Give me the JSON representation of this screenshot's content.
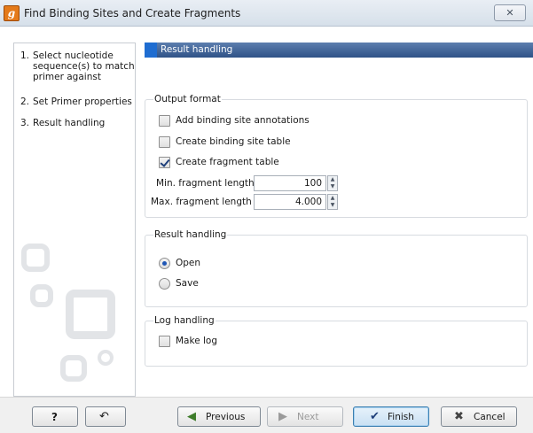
{
  "window": {
    "title": "Find Binding Sites and Create Fragments",
    "icon_glyph": "g",
    "close_symbol": "✕"
  },
  "steps": [
    {
      "num": "1.",
      "label": "Select nucleotide sequence(s) to match primer against"
    },
    {
      "num": "2.",
      "label": "Set Primer properties"
    },
    {
      "num": "3.",
      "label": "Result handling"
    }
  ],
  "section_header": "Result handling",
  "output_format": {
    "title": "Output format",
    "options": [
      {
        "label": "Add binding site annotations",
        "checked": false
      },
      {
        "label": "Create binding site table",
        "checked": false
      },
      {
        "label": "Create fragment table",
        "checked": true
      }
    ],
    "min_length": {
      "label": "Min. fragment length",
      "value": "100"
    },
    "max_length": {
      "label": "Max. fragment length",
      "value": "4.000"
    }
  },
  "result_handling": {
    "title": "Result handling",
    "options": [
      {
        "label": "Open",
        "selected": true
      },
      {
        "label": "Save",
        "selected": false
      }
    ]
  },
  "log_handling": {
    "title": "Log handling",
    "make_log": {
      "label": "Make log",
      "checked": false
    }
  },
  "buttons": {
    "help": "?",
    "reset_icon": "↶",
    "previous": "Previous",
    "next": "Next",
    "finish": "Finish",
    "cancel": "Cancel"
  },
  "colors": {
    "header_bar": "#2f5287",
    "accent": "#1f6dd1",
    "app_icon": "#e47a1a"
  }
}
